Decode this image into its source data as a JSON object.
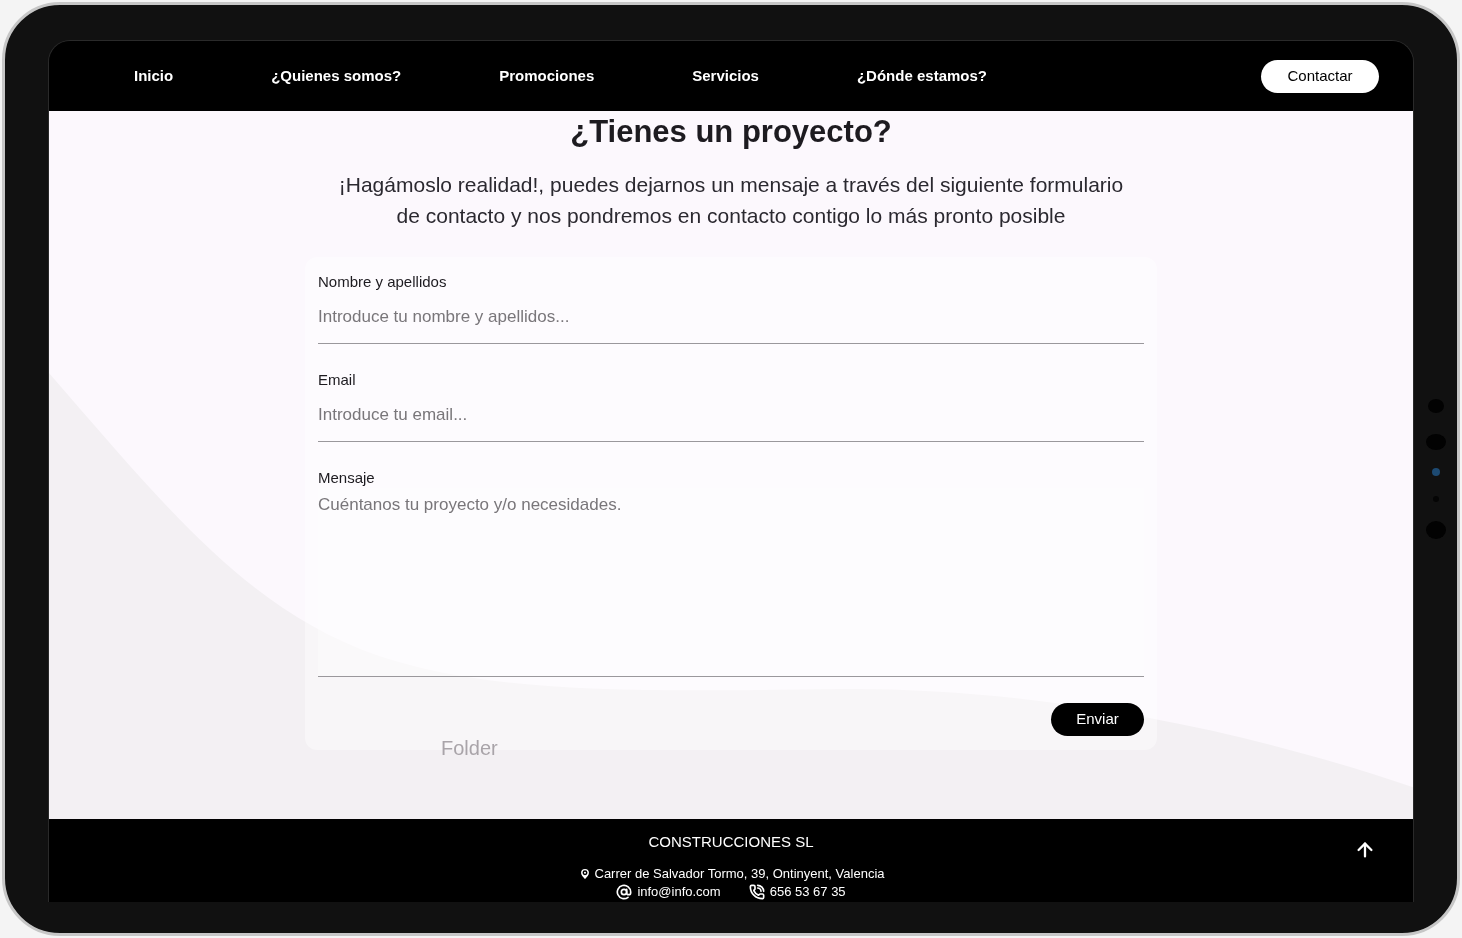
{
  "nav": {
    "items": [
      "Inicio",
      "¿Quienes somos?",
      "Promociones",
      "Servicios",
      "¿Dónde estamos?"
    ],
    "cta": "Contactar"
  },
  "hero": {
    "title": "¿Tienes un proyecto?",
    "subtitle": "¡Hagámoslo realidad!, puedes dejarnos un mensaje a través del siguiente formulario de contacto y nos pondremos en contacto contigo lo más pronto posible"
  },
  "form": {
    "fields": [
      {
        "kind": "input",
        "label": "Nombre y apellidos",
        "placeholder": "Introduce tu nombre y apellidos..."
      },
      {
        "kind": "input",
        "label": "Email",
        "placeholder": "Introduce tu email..."
      },
      {
        "kind": "textarea",
        "label": "Mensaje",
        "placeholder": "Cuéntanos tu proyecto y/o necesidades."
      }
    ],
    "submit": "Enviar"
  },
  "overlay_text": "Folder",
  "footer": {
    "company": "CONSTRUCCIONES SL",
    "address": "Carrer de Salvador Tormo, 39, Ontinyent, Valencia",
    "email": "info@info.com",
    "phone": "656 53 67 35"
  }
}
